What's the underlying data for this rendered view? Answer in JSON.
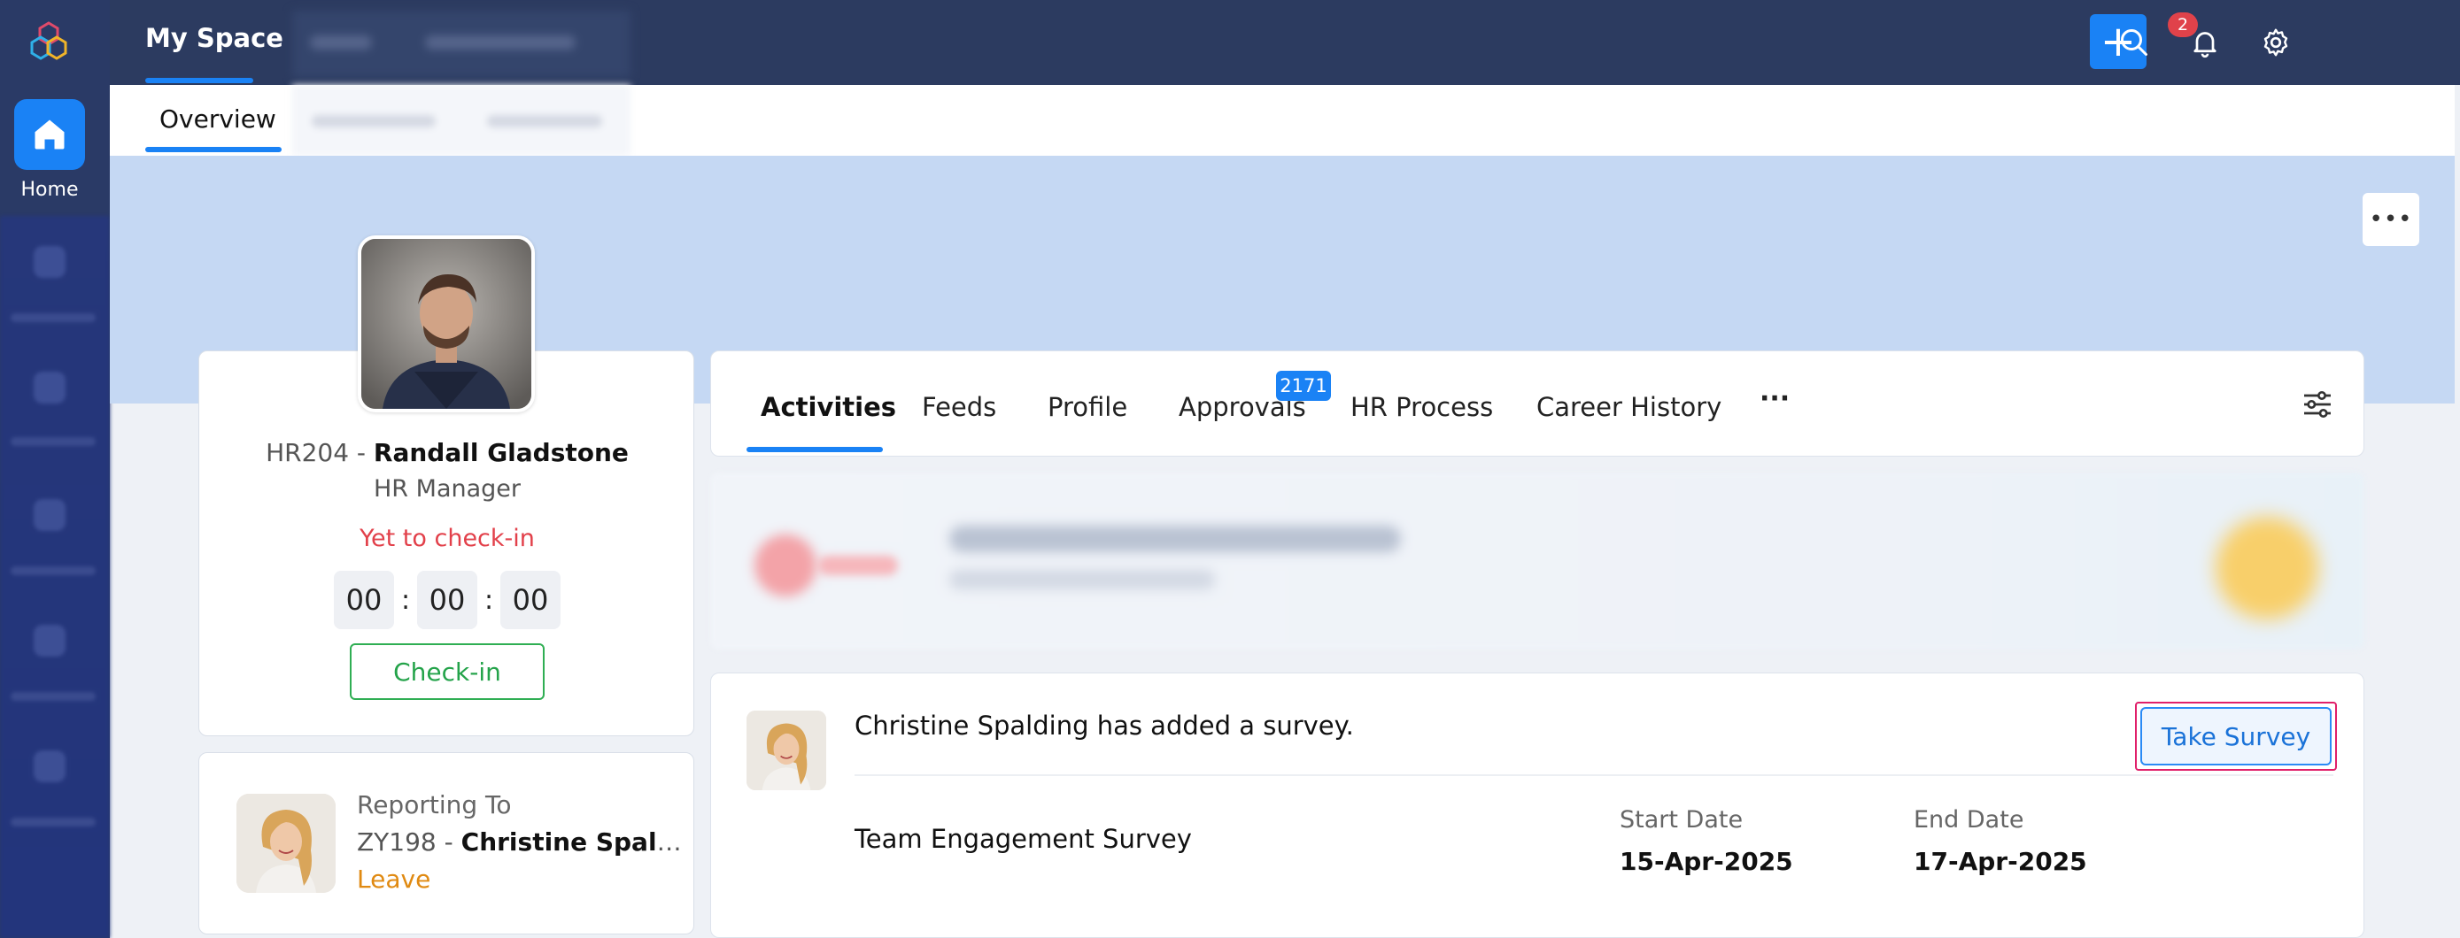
{
  "rail": {
    "home_label": "Home"
  },
  "topbar": {
    "active_tab": "My Space",
    "notification_count": "2",
    "add_label": "+"
  },
  "subtabs": {
    "active": "Overview"
  },
  "profile": {
    "emp_id": "HR204",
    "name": "Randall Gladstone",
    "role": "HR Manager",
    "status": "Yet to check-in",
    "timer": {
      "hours": "00",
      "minutes": "00",
      "seconds": "00",
      "sep": ":"
    },
    "checkin_label": "Check-in"
  },
  "reporting": {
    "label": "Reporting To",
    "emp_id": "ZY198",
    "name": "Christine Spaldi...",
    "status": "Leave"
  },
  "activity_tabs": {
    "items": [
      "Activities",
      "Feeds",
      "Profile",
      "Approvals",
      "HR Process",
      "Career History"
    ],
    "approvals_badge": "2171",
    "more": "···"
  },
  "survey": {
    "message": "Christine Spalding has added a survey.",
    "action_label": "Take Survey",
    "name": "Team Engagement Survey",
    "start_label": "Start Date",
    "start_value": "15-Apr-2025",
    "end_label": "End Date",
    "end_value": "17-Apr-2025"
  },
  "colors": {
    "accent": "#1a82f5",
    "topbar": "#2c3b60",
    "rail": "#2a3a66",
    "banner": "#c5d8f3",
    "status_red": "#e2404a",
    "checkin_green": "#24a34a",
    "leave_orange": "#e08a12"
  }
}
